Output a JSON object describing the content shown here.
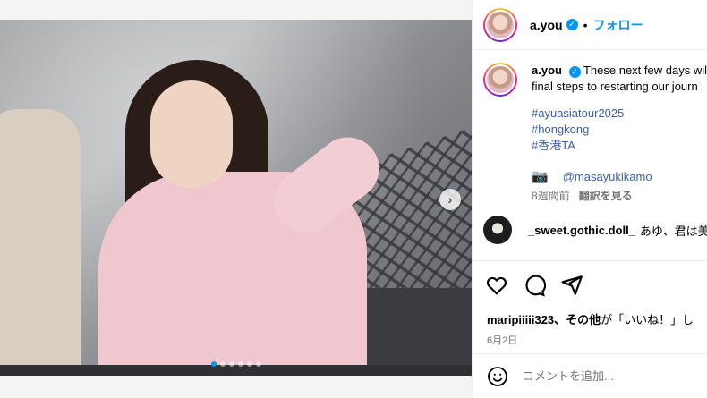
{
  "post": {
    "username": "a.you",
    "separator": "•",
    "follow_label": "フォロー",
    "carousel": {
      "slide_count": 6,
      "active_index": 0
    }
  },
  "caption": {
    "username": "a.you",
    "line1": "These next few days wil",
    "line2": "final steps to restarting our journ",
    "hashtags": [
      "#ayuasiatour2025",
      "#hongkong",
      "#香港TA"
    ],
    "camera_icon": "📷",
    "mention": "@masayukikamo",
    "time_ago": "8週間前",
    "translate_label": "翻訳を見る"
  },
  "comment": {
    "username": "_sweet.gothic.doll_",
    "text": "あゆ、君は美"
  },
  "likes": {
    "prefix": "maripiiiii323、",
    "bold": "その他",
    "suffix": "が「いいね！」し"
  },
  "date": "6月2日",
  "comment_box": {
    "placeholder": "コメントを追加..."
  },
  "icons": {
    "verified": "verified-badge-icon",
    "like": "heart-icon",
    "comment": "comment-bubble-icon",
    "share": "paper-plane-icon",
    "emoji": "emoji-smile-icon",
    "next": "chevron-right-icon"
  },
  "colors": {
    "accent": "#0095f6",
    "link": "#3b5fa8",
    "secondary": "#737373"
  }
}
